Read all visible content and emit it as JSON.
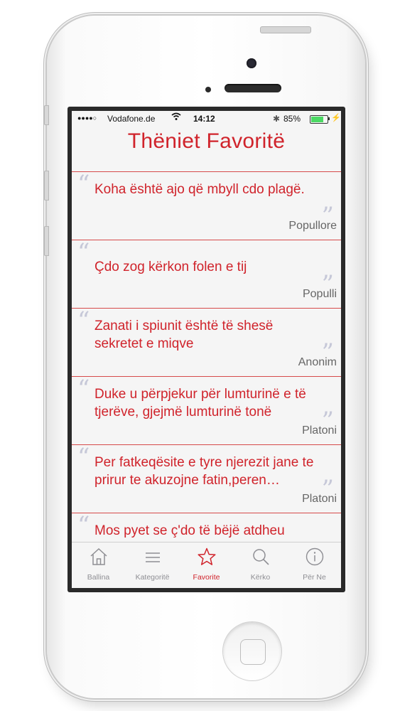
{
  "status": {
    "signal": "●●●●○",
    "carrier": "Vodafone.de",
    "time": "14:12",
    "battery_pct": "85%",
    "battery_level": 0.85,
    "bluetooth": "✱",
    "charge": "⚡"
  },
  "header": {
    "title": "Thëniet Favoritë"
  },
  "quote_marks": {
    "open": "“",
    "close": "”"
  },
  "quotes": [
    {
      "text": "Koha është ajo që mbyll cdo plagë.",
      "author": "Popullore"
    },
    {
      "text": "Çdo zog kërkon folen e tij",
      "author": "Populli"
    },
    {
      "text": "Zanati i spiunit është të shesë sekretet e miqve",
      "author": "Anonim"
    },
    {
      "text": "Duke u përpjekur për lumturinë e të tjerëve, gjejmë lumturinë tonë",
      "author": "Platoni"
    },
    {
      "text": "Per fatkeqësite e tyre njerezit jane te prirur te akuzojne fatin,peren…",
      "author": "Platoni"
    },
    {
      "text": "Mos pyet se ç'do të bëjë atdheu",
      "author": ""
    }
  ],
  "tabs": [
    {
      "label": "Ballina",
      "icon": "house-icon"
    },
    {
      "label": "Kategoritë",
      "icon": "list-icon"
    },
    {
      "label": "Favorite",
      "icon": "star-icon",
      "active": true
    },
    {
      "label": "Kërko",
      "icon": "search-icon"
    },
    {
      "label": "Për Ne",
      "icon": "info-icon"
    }
  ],
  "colors": {
    "accent": "#d0232b",
    "inactive": "#8e8e93",
    "divider": "#d64a4a"
  }
}
